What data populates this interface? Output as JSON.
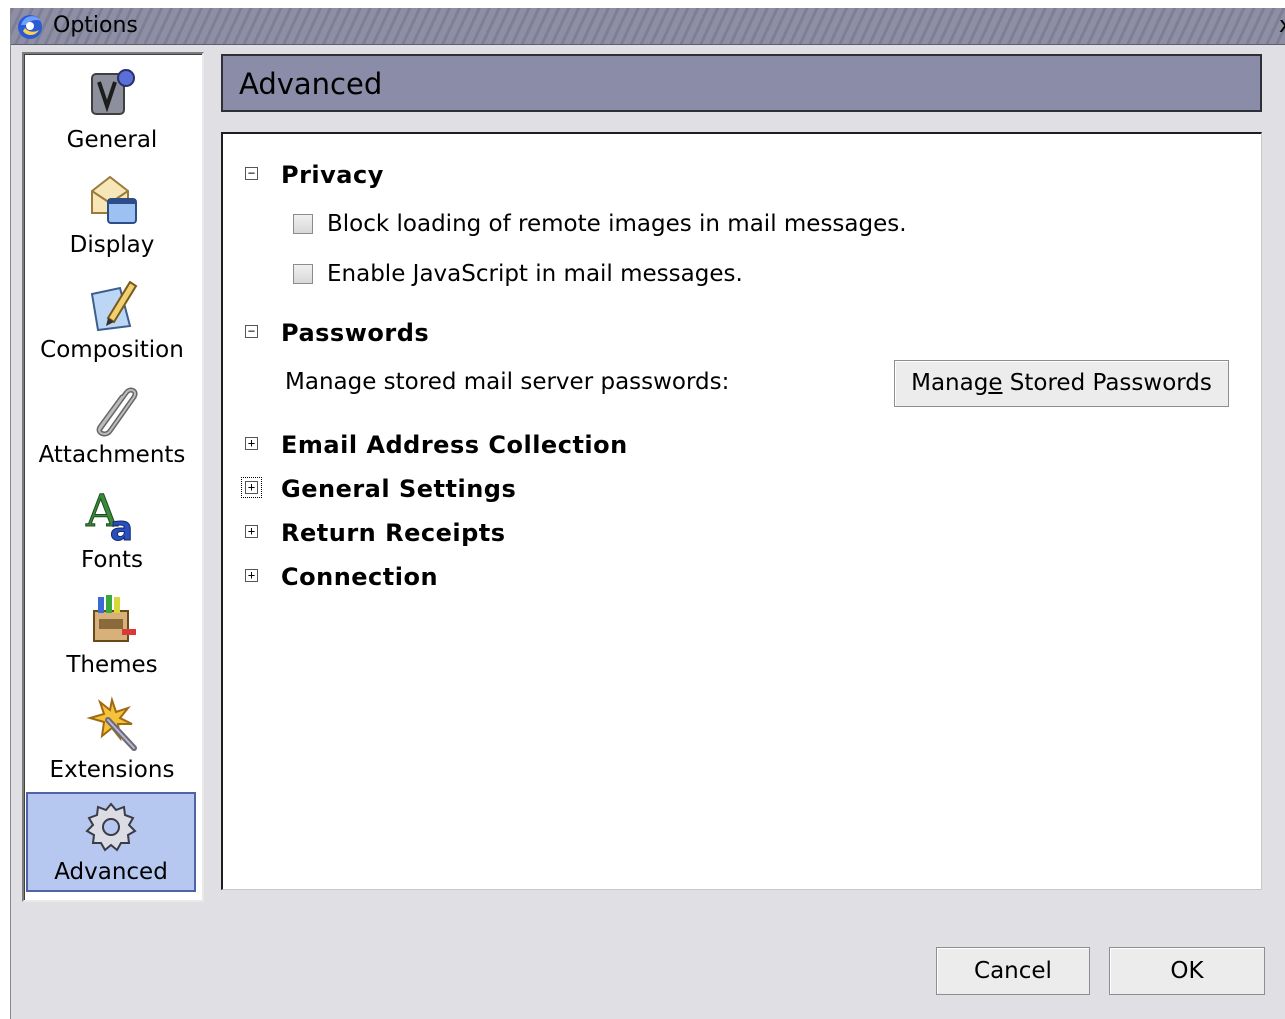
{
  "window": {
    "title": "Options",
    "close_glyph": "x"
  },
  "sidebar": {
    "items": [
      {
        "label": "General",
        "icon": "general-icon"
      },
      {
        "label": "Display",
        "icon": "display-icon"
      },
      {
        "label": "Composition",
        "icon": "composition-icon"
      },
      {
        "label": "Attachments",
        "icon": "attachments-icon"
      },
      {
        "label": "Fonts",
        "icon": "fonts-icon"
      },
      {
        "label": "Themes",
        "icon": "themes-icon"
      },
      {
        "label": "Extensions",
        "icon": "extensions-icon"
      },
      {
        "label": "Advanced",
        "icon": "advanced-gear-icon",
        "selected": true
      }
    ]
  },
  "header": {
    "title": "Advanced"
  },
  "sections": {
    "privacy": {
      "title": "Privacy",
      "expanded": true,
      "options": [
        {
          "label": "Block loading of remote images in mail messages.",
          "checked": false
        },
        {
          "label": "Enable JavaScript in mail messages.",
          "checked": false
        }
      ]
    },
    "passwords": {
      "title": "Passwords",
      "expanded": true,
      "manage_label": "Manage stored mail server passwords:",
      "button_before": "Manag",
      "button_accel": "e",
      "button_after": " Stored Passwords"
    },
    "email_address_collection": {
      "title": "Email Address Collection",
      "expanded": false
    },
    "general_settings": {
      "title": "General Settings",
      "expanded": false,
      "focused": true
    },
    "return_receipts": {
      "title": "Return Receipts",
      "expanded": false
    },
    "connection": {
      "title": "Connection",
      "expanded": false
    }
  },
  "twisty": {
    "expanded": "−",
    "collapsed": "+"
  },
  "footer": {
    "cancel_label": "Cancel",
    "ok_label": "OK"
  },
  "colors": {
    "window_bg": "#e0dfe3",
    "header_bg": "#8a8ca8",
    "selected_bg": "#b7c8f0",
    "selected_border": "#4f63a8",
    "titlebar": "#8e8ea4"
  }
}
